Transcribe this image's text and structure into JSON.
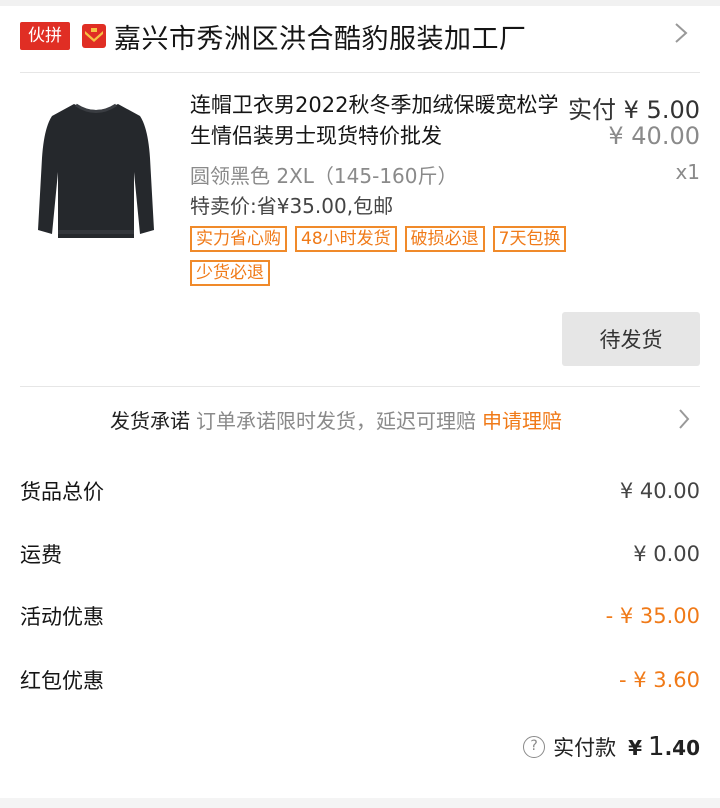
{
  "shop": {
    "tag": "伙拼",
    "name": "嘉兴市秀洲区洪合酷豹服装加工厂"
  },
  "product": {
    "title": "连帽卫衣男2022秋冬季加绒保暖宽松学生情侣装男士现货特价批发",
    "price_actual": "实付 ¥ 5.00",
    "price_original": "¥ 40.00",
    "spec": "圆领黑色 2XL（145-160斤）",
    "quantity": "x1",
    "promo": "特卖价:省¥35.00,包邮",
    "badges": [
      "实力省心购",
      "48小时发货",
      "破损必退",
      "7天包换",
      "少货必退"
    ],
    "status_button": "待发货",
    "image_icon": "sweater-image"
  },
  "promise": {
    "title": "发货承诺",
    "desc": "订单承诺限时发货，延迟可理赔",
    "action": "申请理赔"
  },
  "summary": [
    {
      "label": "货品总价",
      "value": "¥ 40.00",
      "highlight": false
    },
    {
      "label": "运费",
      "value": "¥ 0.00",
      "highlight": false
    },
    {
      "label": "活动优惠",
      "value": "- ¥ 35.00",
      "highlight": true
    },
    {
      "label": "红包优惠",
      "value": "- ¥ 3.60",
      "highlight": true
    }
  ],
  "total": {
    "label": "实付款",
    "currency": "¥",
    "integer": "1",
    "decimal": ".40"
  },
  "colors": {
    "accent": "#f07a18",
    "brand_red": "#e02e24"
  }
}
